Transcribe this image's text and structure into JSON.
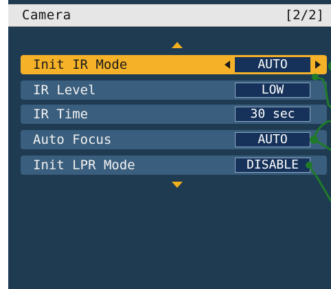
{
  "header": {
    "title": "Camera",
    "page_indicator": "[2/2]"
  },
  "menu": {
    "items": [
      {
        "label": "Init IR Mode",
        "value": "AUTO",
        "selected": true
      },
      {
        "label": "IR Level",
        "value": "LOW",
        "selected": false
      },
      {
        "label": "IR Time",
        "value": "30 sec",
        "selected": false
      },
      {
        "label": "Auto Focus",
        "value": "AUTO",
        "selected": false
      },
      {
        "label": "Init LPR Mode",
        "value": "DISABLE",
        "selected": false
      }
    ]
  },
  "colors": {
    "background": "#1e3b52",
    "row": "#3a5e7d",
    "selected_row": "#f5b228",
    "value_box": "#16325a",
    "scroll_arrow": "#f3b01e",
    "annotation_line": "#1f7a2a"
  },
  "icons": {
    "scroll_up": "triangle-up",
    "scroll_down": "triangle-down",
    "value_decrease": "triangle-left",
    "value_increase": "triangle-right"
  }
}
